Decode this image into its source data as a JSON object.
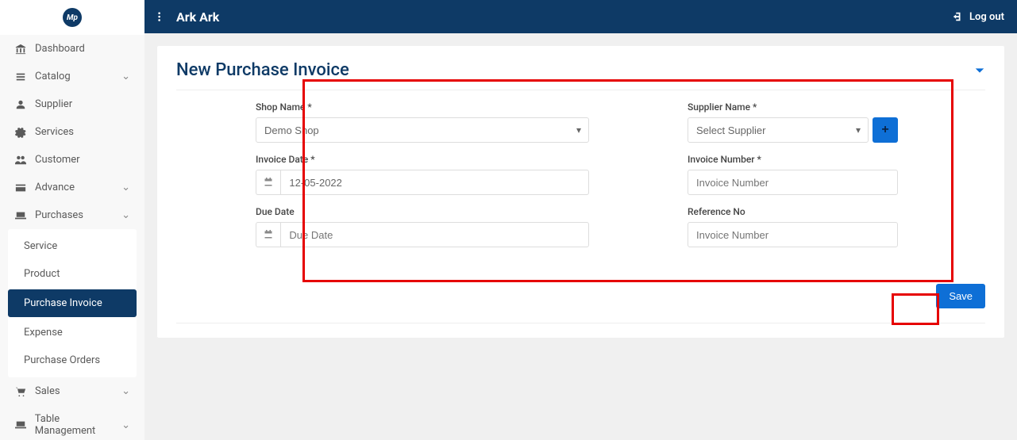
{
  "app": {
    "logo_text": "Mp",
    "title": "Ark Ark",
    "logout_label": "Log out"
  },
  "sidebar": {
    "items": [
      {
        "icon": "bank-icon",
        "label": "Dashboard",
        "expandable": false
      },
      {
        "icon": "list-icon",
        "label": "Catalog",
        "expandable": true
      },
      {
        "icon": "user-icon",
        "label": "Supplier",
        "expandable": false
      },
      {
        "icon": "gear-icon",
        "label": "Services",
        "expandable": false
      },
      {
        "icon": "users-icon",
        "label": "Customer",
        "expandable": false
      },
      {
        "icon": "card-icon",
        "label": "Advance",
        "expandable": true
      },
      {
        "icon": "laptop-icon",
        "label": "Purchases",
        "expandable": true,
        "expanded": true
      },
      {
        "icon": "cart-icon",
        "label": "Sales",
        "expandable": true
      },
      {
        "icon": "laptop-icon",
        "label": "Table Management",
        "expandable": true
      }
    ],
    "purchases_sub": [
      {
        "label": "Service",
        "active": false
      },
      {
        "label": "Product",
        "active": false
      },
      {
        "label": "Purchase Invoice",
        "active": true
      },
      {
        "label": "Expense",
        "active": false
      },
      {
        "label": "Purchase Orders",
        "active": false
      }
    ]
  },
  "page": {
    "title": "New Purchase Invoice"
  },
  "form": {
    "shop_name": {
      "label": "Shop Name *",
      "value": "Demo Shop"
    },
    "supplier_name": {
      "label": "Supplier Name *",
      "placeholder": "Select Supplier"
    },
    "invoice_date": {
      "label": "Invoice Date *",
      "value": "12-05-2022"
    },
    "invoice_number": {
      "label": "Invoice Number *",
      "placeholder": "Invoice Number"
    },
    "due_date": {
      "label": "Due Date",
      "placeholder": "Due Date"
    },
    "reference_no": {
      "label": "Reference No",
      "placeholder": "Invoice Number"
    },
    "save_label": "Save",
    "add_label": "+"
  }
}
